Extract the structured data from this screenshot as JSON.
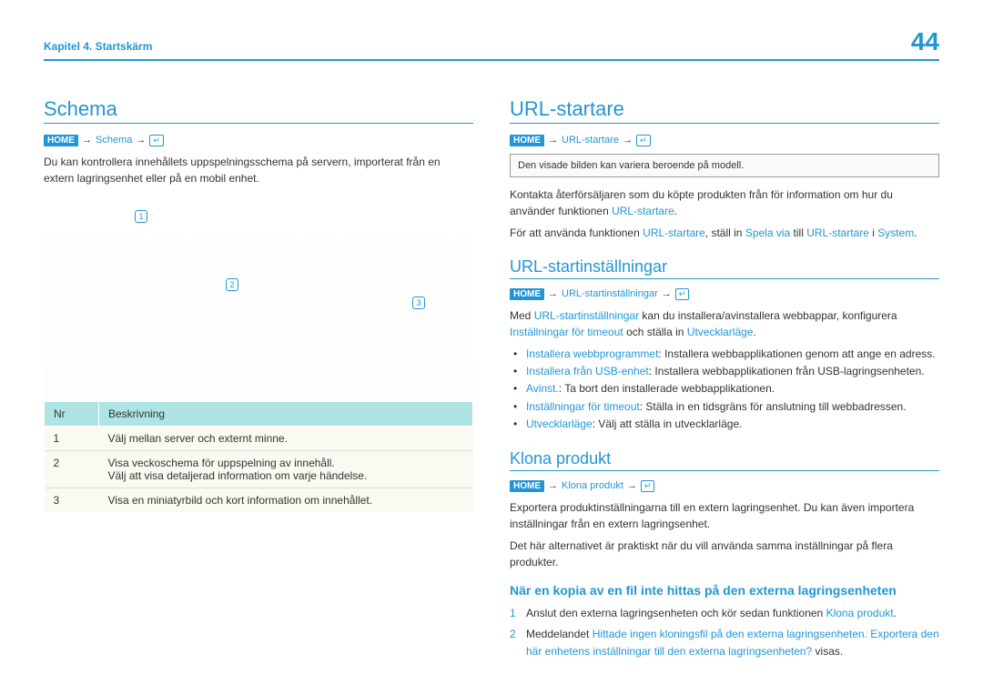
{
  "header": {
    "chapter": "Kapitel 4. Startskärm",
    "page": "44"
  },
  "left": {
    "title": "Schema",
    "bc_link": "Schema",
    "intro": "Du kan kontrollera innehållets uppspelningsschema på servern, importerat från en extern lagringsenhet eller på en mobil enhet.",
    "m1": "1",
    "m2": "2",
    "m3": "3",
    "th_nr": "Nr",
    "th_desc": "Beskrivning",
    "r1n": "1",
    "r1d": "Välj mellan server och externt minne.",
    "r2n": "2",
    "r2d1": "Visa veckoschema för uppspelning av innehåll.",
    "r2d2": "Välj att visa detaljerad information om varje händelse.",
    "r3n": "3",
    "r3d": "Visa en miniatyrbild och kort information om innehållet."
  },
  "right": {
    "url_title": "URL-startare",
    "url_bc": "URL-startare",
    "url_note": "Den visade bilden kan variera beroende på modell.",
    "url_p1a": "Kontakta återförsäljaren som du köpte produkten från för information om hur du använder funktionen ",
    "url_p1b": "URL-startare",
    "url_p2a": "För att använda funktionen ",
    "url_p2b": "URL-startare",
    "url_p2c": ", ställ in ",
    "url_p2d": "Spela via",
    "url_p2e": " till ",
    "url_p2f": "URL-startare",
    "url_p2g": " i ",
    "url_p2h": "System",
    "url_p2i": ".",
    "settings_title": "URL-startinställningar",
    "settings_bc": "URL-startinställningar",
    "settings_p_a": "Med ",
    "settings_p_b": "URL-startinställningar",
    "settings_p_c": " kan du installera/avinstallera webbappar, konfigurera ",
    "settings_p_d": "Inställningar för timeout",
    "settings_p_e": " och ställa in ",
    "settings_p_f": "Utvecklarläge",
    "settings_p_g": ".",
    "b1a": "Installera webbprogrammet",
    "b1b": ": Installera webbapplikationen genom att ange en adress.",
    "b2a": "Installera från USB-enhet",
    "b2b": ": Installera webbapplikationen från USB-lagringsenheten.",
    "b3a": "Avinst.",
    "b3b": ": Ta bort den installerade webbapplikationen.",
    "b4a": "Inställningar för timeout",
    "b4b": ": Ställa in en tidsgräns för anslutning till webbadressen.",
    "b5a": "Utvecklarläge",
    "b5b": ": Välj att ställa in utvecklarläge.",
    "clone_title": "Klona produkt",
    "clone_bc": "Klona produkt",
    "clone_p1": "Exportera produktinställningarna till en extern lagringsenhet. Du kan även importera inställningar från en extern lagringsenhet.",
    "clone_p2": "Det här alternativet är praktiskt när du vill använda samma inställningar på flera produkter.",
    "nofile_title": "När en kopia av en fil inte hittas på den externa lagringsenheten",
    "n1a": "Anslut den externa lagringsenheten och kör sedan funktionen ",
    "n1b": "Klona produkt",
    "n1c": ".",
    "n2a": "Meddelandet ",
    "n2b": "Hittade ingen kloningsfil på den externa lagringsenheten. Exportera den här enhetens inställningar till den externa lagringsenheten?",
    "n2c": " visas."
  }
}
